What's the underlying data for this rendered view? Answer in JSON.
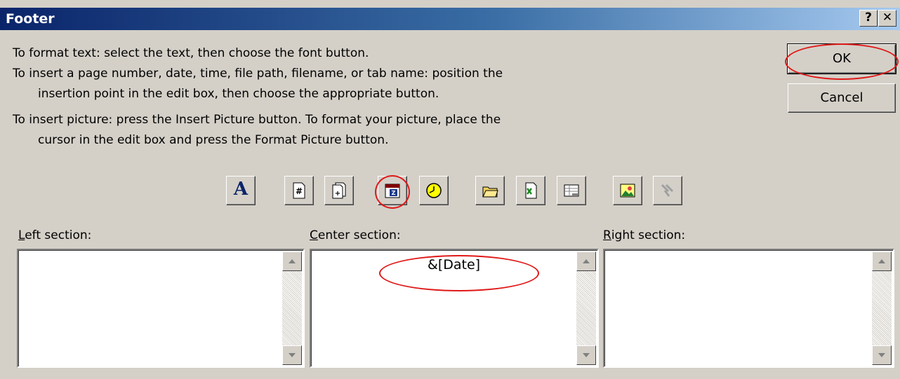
{
  "window": {
    "title": "Footer",
    "help_label": "?",
    "close_label": "✕"
  },
  "instructions": [
    "To format text:  select the text, then choose the font button.",
    "To insert a page number, date, time, file path, filename, or tab name:  position the",
    "insertion point in the edit box, then choose the appropriate button.",
    "To insert picture: press the Insert Picture button.  To format your picture, place the",
    "cursor in the edit box and press the Format Picture button."
  ],
  "buttons": {
    "ok": "OK",
    "cancel": "Cancel"
  },
  "toolbar": {
    "font": "A",
    "icons": [
      "font-icon",
      "page-number-icon",
      "total-pages-icon",
      "date-icon",
      "time-icon",
      "file-path-icon",
      "filename-icon",
      "sheet-name-icon",
      "insert-picture-icon",
      "format-picture-icon"
    ]
  },
  "sections": {
    "left": {
      "mnemonic": "L",
      "rest": "eft section:",
      "content": ""
    },
    "center": {
      "mnemonic": "C",
      "rest": "enter section:",
      "content": "&[Date]"
    },
    "right": {
      "mnemonic": "R",
      "rest": "ight section:",
      "content": ""
    }
  },
  "colors": {
    "annotation": "#e01818",
    "title_start": "#0a246a",
    "title_end": "#a6caf0"
  }
}
